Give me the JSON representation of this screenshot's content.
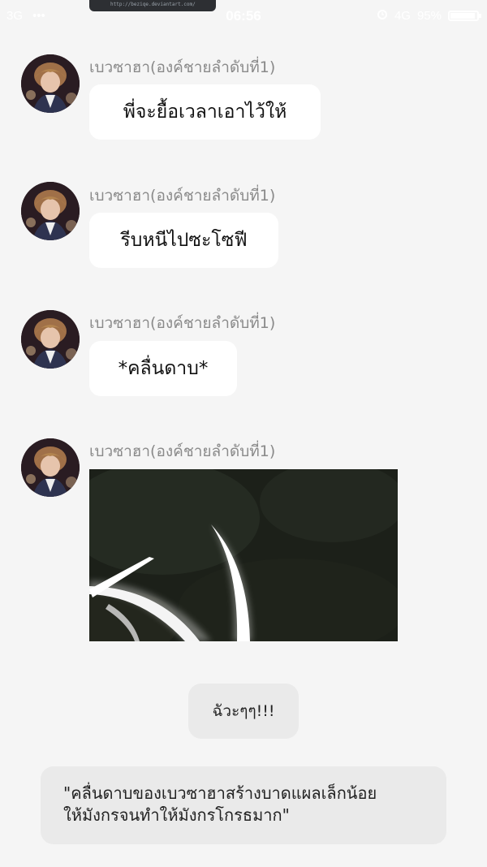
{
  "status_bar": {
    "network": "3G",
    "dots": "•••",
    "time": "06:56",
    "data_type": "4G",
    "battery": "95%",
    "battery_level": 0.95,
    "notch_text": "http://beziqe.deviantart.com/"
  },
  "messages": [
    {
      "sender": "เบวซาฮา(องค์ชายลำดับที่1)",
      "text": "พี่จะยื้อเวลาเอาไว้ให้"
    },
    {
      "sender": "เบวซาฮา(องค์ชายลำดับที่1)",
      "text": "รีบหนีไปซะโซฟี"
    },
    {
      "sender": "เบวซาฮา(องค์ชายลำดับที่1)",
      "text": "*คลื่นดาบ*"
    },
    {
      "sender": "เบวซาฮา(องค์ชายลำดับที่1)",
      "image": "sword-wave-slash-image"
    }
  ],
  "reaction": {
    "text": "ฉัวะๆๆ!!!"
  },
  "narration": {
    "line1": "\"คลื่นดาบของเบวซาฮาสร้างบาดแผลเล็กน้อย",
    "line2": "ให้มังกรจนทำให้มังกรโกรธมาก\""
  },
  "colors": {
    "background": "#f5f5f5",
    "bubble": "#ffffff",
    "system_bubble": "#eaeaea",
    "sender_text": "#8a8a8a"
  }
}
